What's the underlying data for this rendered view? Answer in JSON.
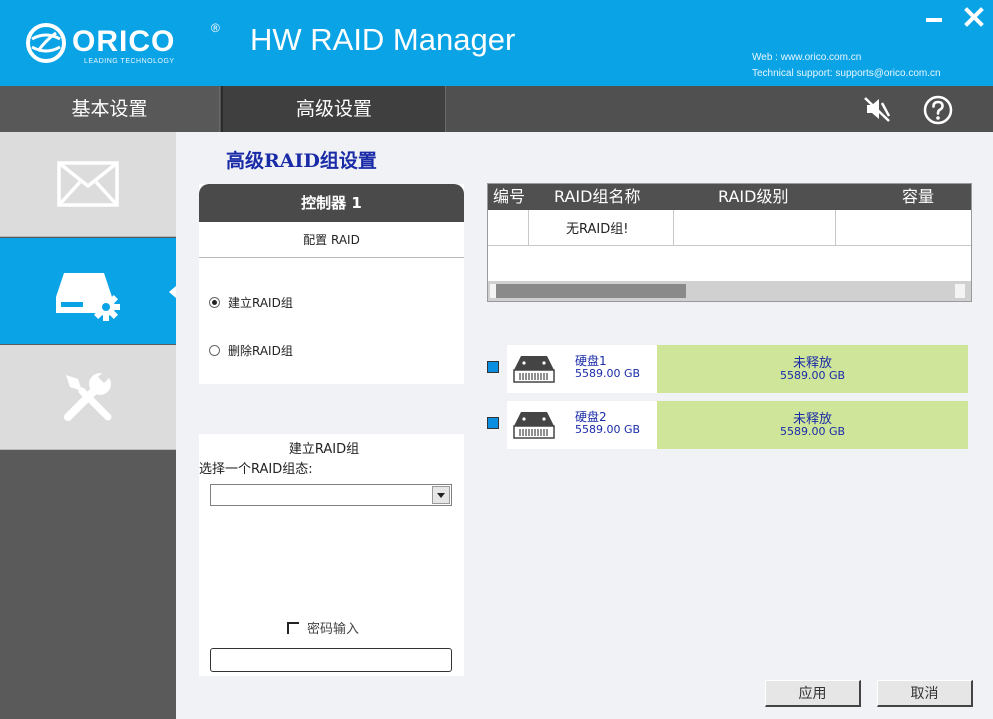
{
  "header": {
    "app_title": "HW RAID Manager",
    "web": "Web : www.orico.com.cn",
    "support": "Technical support: supports@orico.com.cn",
    "logo": {
      "brand": "ORICO",
      "tagline": "LEADING TECHNOLOGY",
      "registered": "®"
    },
    "accent_color": "#0aa3e6"
  },
  "tabs": [
    {
      "label": "基本设置",
      "active": false
    },
    {
      "label": "高级设置",
      "active": true
    }
  ],
  "toolbar_icons": [
    "mute-icon",
    "help-icon"
  ],
  "sidebar": {
    "items": [
      {
        "icon": "mail-icon",
        "active": false
      },
      {
        "icon": "raid-settings-icon",
        "active": true
      },
      {
        "icon": "tools-icon",
        "active": false
      }
    ]
  },
  "main": {
    "section_title": "高级RAID组设置",
    "controller": {
      "title": "控制器 1",
      "config_label": "配置 RAID",
      "options": [
        {
          "label": "建立RAID组",
          "checked": true
        },
        {
          "label": "删除RAID组",
          "checked": false
        }
      ]
    },
    "create_group": {
      "title": "建立RAID组",
      "select_label": "选择一个RAID组态:",
      "selected_value": "",
      "password_label": "密码输入",
      "password_checked": false,
      "password_value": ""
    },
    "table": {
      "headers": [
        "编号",
        "RAID组名称",
        "RAID级别",
        "容量"
      ],
      "empty_text": "无RAID组!"
    },
    "disks": [
      {
        "name": "硬盘1",
        "size": "5589.00 GB",
        "status": "未释放",
        "bar_size": "5589.00 GB"
      },
      {
        "name": "硬盘2",
        "size": "5589.00 GB",
        "status": "未释放",
        "bar_size": "5589.00 GB"
      }
    ],
    "buttons": {
      "apply": "应用",
      "cancel": "取消"
    }
  }
}
